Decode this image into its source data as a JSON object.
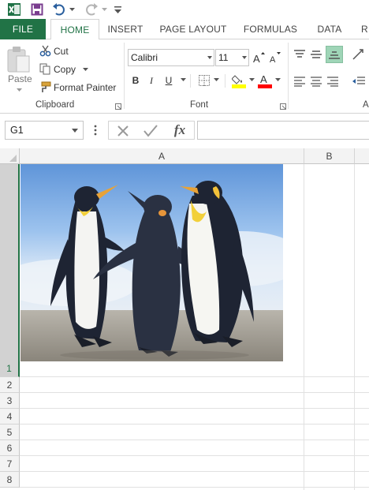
{
  "app": {
    "title": "Microsoft Excel",
    "accent": "#217346"
  },
  "qat": {
    "icons": [
      "excel-logo-icon",
      "save-icon",
      "undo-icon",
      "redo-icon",
      "customize-icon"
    ]
  },
  "tabs": {
    "file": "FILE",
    "home": "HOME",
    "insert": "INSERT",
    "page_layout": "PAGE LAYOUT",
    "formulas": "FORMULAS",
    "data": "DATA",
    "overflow": "R"
  },
  "clipboard": {
    "paste": "Paste",
    "cut": "Cut",
    "copy": "Copy",
    "format_painter": "Format Painter",
    "group_label": "Clipboard"
  },
  "font": {
    "name": "Calibri",
    "size": "11",
    "bold": "B",
    "italic": "I",
    "underline": "U",
    "group_label": "Font",
    "fill_color": "#ffff00",
    "font_color": "#ff0000"
  },
  "alignment": {
    "group_label_partial": "A"
  },
  "formula_bar": {
    "name_box": "G1",
    "fx": "fx",
    "value": ""
  },
  "grid": {
    "columns": [
      "A",
      "B"
    ],
    "rows": [
      "1",
      "2",
      "3",
      "4",
      "5",
      "6",
      "7",
      "8"
    ],
    "selected_cell": "G1",
    "image_subject": "penguins-photo"
  }
}
